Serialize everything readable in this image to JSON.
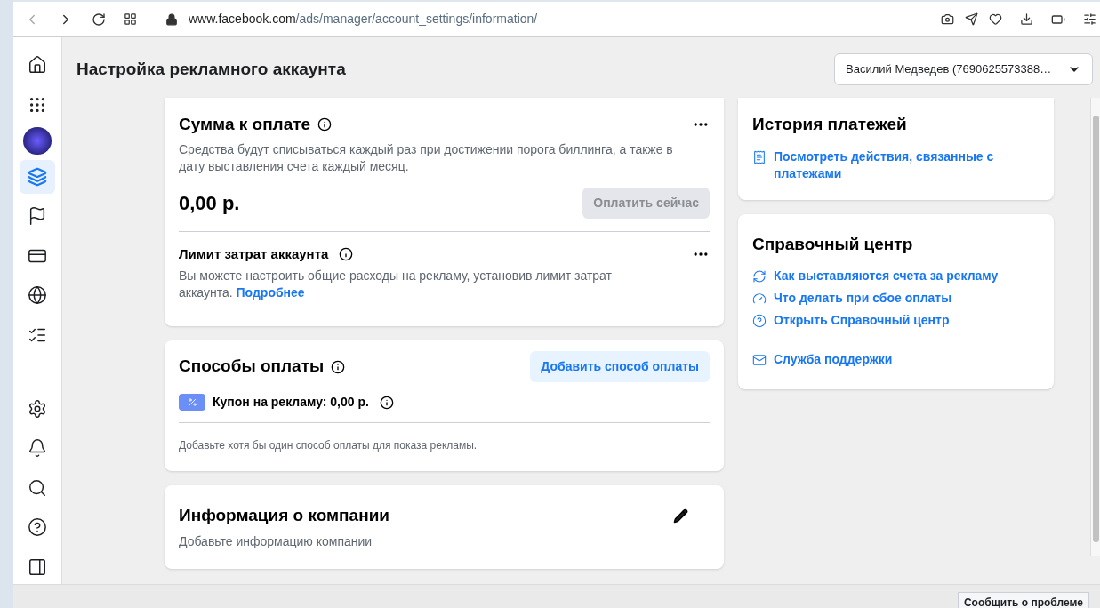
{
  "browser": {
    "url_host": "www.facebook.com",
    "url_path": "/ads/manager/account_settings/information/"
  },
  "sidebar": {
    "items": [
      {
        "kind": "home",
        "selected": false
      },
      {
        "kind": "apps",
        "selected": false
      },
      {
        "kind": "avatar",
        "selected": false
      },
      {
        "kind": "ads",
        "selected": true
      },
      {
        "kind": "flag",
        "selected": false
      },
      {
        "kind": "card",
        "selected": false
      },
      {
        "kind": "globe",
        "selected": false
      },
      {
        "kind": "settings-list",
        "selected": false
      }
    ],
    "bottom_items": [
      {
        "kind": "gear"
      },
      {
        "kind": "bell"
      },
      {
        "kind": "search"
      },
      {
        "kind": "help"
      },
      {
        "kind": "panel"
      }
    ]
  },
  "page": {
    "title": "Настройка рекламного аккаунта",
    "account_select": "Василий Медведев (7690625573388…"
  },
  "amount_card": {
    "title": "Сумма к оплате",
    "description": "Средства будут списываться каждый раз при достижении порога биллинга, а также в дату выставления счета каждый месяц.",
    "amount": "0,00 р.",
    "pay_button": {
      "label": "Оплатить сейчас",
      "disabled": true
    },
    "limit": {
      "title": "Лимит затрат аккаунта",
      "description": "Вы можете настроить общие расходы на рекламу, установив лимит затрат аккаунта.",
      "link": "Подробнее"
    }
  },
  "payment_methods": {
    "title": "Способы оплаты",
    "add_button": "Добавить способ оплаты",
    "coupon": "Купон на рекламу: 0,00 р.",
    "note": "Добавьте хотя бы один способ оплаты для показа рекламы."
  },
  "company_info": {
    "title": "Информация о компании",
    "description": "Добавьте информацию компании"
  },
  "payment_history": {
    "title": "История платежей",
    "links": [
      {
        "kind": "receipt",
        "label": "Посмотреть действия, связанные с платежами"
      }
    ]
  },
  "help_center": {
    "title": "Справочный центр",
    "links": [
      {
        "kind": "refresh",
        "label": "Как выставляются счета за рекламу"
      },
      {
        "kind": "gauge",
        "label": "Что делать при сбое оплаты"
      },
      {
        "kind": "help",
        "label": "Открыть Справочный центр"
      }
    ],
    "support_links": [
      {
        "kind": "mail",
        "label": "Служба поддержки"
      }
    ]
  },
  "report_button": "Сообщить о проблеме"
}
